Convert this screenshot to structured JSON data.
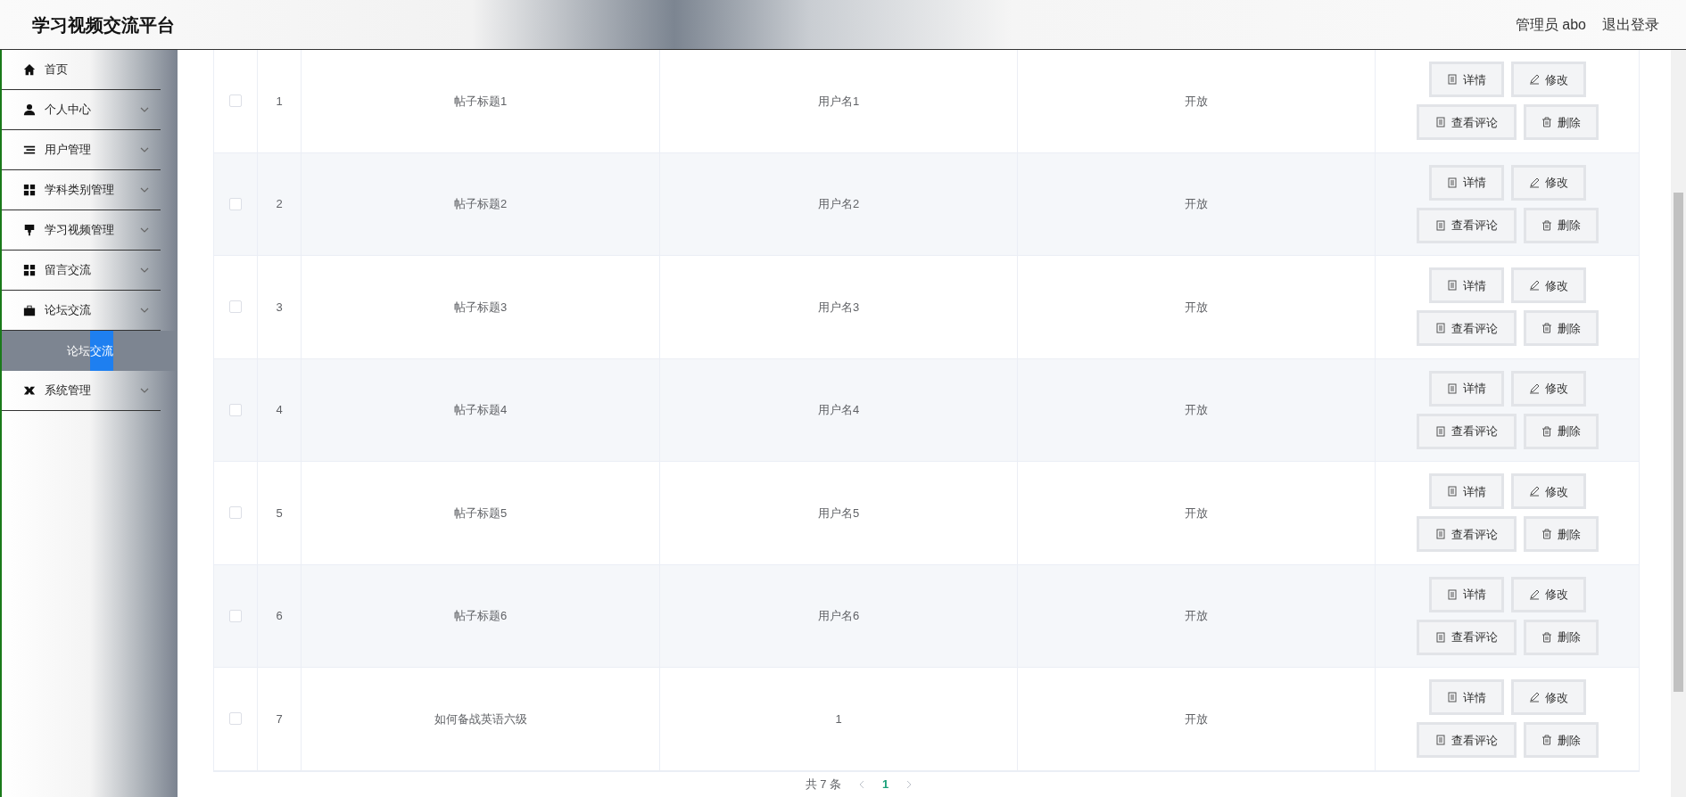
{
  "header": {
    "title": "学习视频交流平台",
    "user": "管理员 abo",
    "logout": "退出登录"
  },
  "sidebar": {
    "items": [
      {
        "label": "首页",
        "kind": "home",
        "expandable": false
      },
      {
        "label": "个人中心",
        "kind": "user",
        "expandable": true
      },
      {
        "label": "用户管理",
        "kind": "list",
        "expandable": true
      },
      {
        "label": "学科类别管理",
        "kind": "grid",
        "expandable": true
      },
      {
        "label": "学习视频管理",
        "kind": "pin",
        "expandable": true
      },
      {
        "label": "留言交流",
        "kind": "grid",
        "expandable": true
      },
      {
        "label": "论坛交流",
        "kind": "case",
        "expandable": true,
        "expanded": true,
        "children": [
          {
            "label": "论坛交流",
            "selected": true
          }
        ]
      },
      {
        "label": "系统管理",
        "kind": "gear",
        "expandable": true
      }
    ]
  },
  "table": {
    "rows": [
      {
        "checked": false,
        "index": "1",
        "title": "帖子标题1",
        "user": "用户名1",
        "status": "开放",
        "actions": [
          {
            "label": "详情",
            "kind": "doc"
          },
          {
            "label": "修改",
            "kind": "edit"
          },
          {
            "label": "查看评论",
            "kind": "doc"
          },
          {
            "label": "删除",
            "kind": "trash"
          }
        ]
      },
      {
        "checked": false,
        "index": "2",
        "title": "帖子标题2",
        "user": "用户名2",
        "status": "开放",
        "actions": [
          {
            "label": "详情",
            "kind": "doc"
          },
          {
            "label": "修改",
            "kind": "edit"
          },
          {
            "label": "查看评论",
            "kind": "doc"
          },
          {
            "label": "删除",
            "kind": "trash"
          }
        ]
      },
      {
        "checked": false,
        "index": "3",
        "title": "帖子标题3",
        "user": "用户名3",
        "status": "开放",
        "actions": [
          {
            "label": "详情",
            "kind": "doc"
          },
          {
            "label": "修改",
            "kind": "edit"
          },
          {
            "label": "查看评论",
            "kind": "doc"
          },
          {
            "label": "删除",
            "kind": "trash"
          }
        ]
      },
      {
        "checked": false,
        "index": "4",
        "title": "帖子标题4",
        "user": "用户名4",
        "status": "开放",
        "actions": [
          {
            "label": "详情",
            "kind": "doc"
          },
          {
            "label": "修改",
            "kind": "edit"
          },
          {
            "label": "查看评论",
            "kind": "doc"
          },
          {
            "label": "删除",
            "kind": "trash"
          }
        ]
      },
      {
        "checked": false,
        "index": "5",
        "title": "帖子标题5",
        "user": "用户名5",
        "status": "开放",
        "actions": [
          {
            "label": "详情",
            "kind": "doc"
          },
          {
            "label": "修改",
            "kind": "edit"
          },
          {
            "label": "查看评论",
            "kind": "doc"
          },
          {
            "label": "删除",
            "kind": "trash"
          }
        ]
      },
      {
        "checked": false,
        "index": "6",
        "title": "帖子标题6",
        "user": "用户名6",
        "status": "开放",
        "actions": [
          {
            "label": "详情",
            "kind": "doc"
          },
          {
            "label": "修改",
            "kind": "edit"
          },
          {
            "label": "查看评论",
            "kind": "doc"
          },
          {
            "label": "删除",
            "kind": "trash"
          }
        ]
      },
      {
        "checked": false,
        "index": "7",
        "title": "如何备战英语六级",
        "user": "1",
        "status": "开放",
        "actions": [
          {
            "label": "详情",
            "kind": "doc"
          },
          {
            "label": "修改",
            "kind": "edit"
          },
          {
            "label": "查看评论",
            "kind": "doc"
          },
          {
            "label": "删除",
            "kind": "trash"
          }
        ]
      }
    ]
  },
  "pagination": {
    "total": "共 7 条",
    "pages": [
      {
        "label": "1",
        "selected": true
      }
    ]
  }
}
